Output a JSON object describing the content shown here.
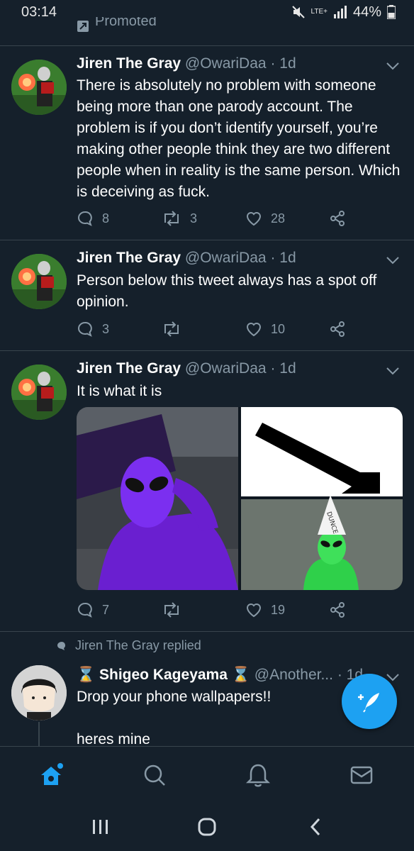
{
  "status_bar": {
    "time": "03:14",
    "network": "LTE+",
    "battery": "44%"
  },
  "promoted_label": "Promoted",
  "tweets": [
    {
      "name": "Jiren The Gray",
      "handle": "@OwariDaa",
      "sep": "·",
      "time": "1d",
      "text": "There is absolutely no problem with someone being more than one parody account. The problem is if you don’t identify yourself, you’re making other people think they are two different people when in reality is the same person. Which is deceiving as fuck.",
      "replies": "8",
      "retweets": "3",
      "likes": "28"
    },
    {
      "name": "Jiren The Gray",
      "handle": "@OwariDaa",
      "sep": "·",
      "time": "1d",
      "text": "Person below this tweet always has a spot off opinion.",
      "replies": "3",
      "retweets": "",
      "likes": "10"
    },
    {
      "name": "Jiren The Gray",
      "handle": "@OwariDaa",
      "sep": "·",
      "time": "1d",
      "text": "It is what it is",
      "replies": "7",
      "retweets": "",
      "likes": "19",
      "dunce_text": "DUNCE"
    },
    {
      "name": "Shigeo Kageyama",
      "handle": "@Another...",
      "sep": "·",
      "time": "1d",
      "text_line1": "Drop your phone wallpapers!!",
      "text_line2": "heres mine"
    }
  ],
  "replied_label": "Jiren The Gray replied",
  "icons": {
    "reply": "reply-icon",
    "retweet": "retweet-icon",
    "like": "heart-icon",
    "share": "share-icon",
    "home": "home-icon",
    "search": "search-icon",
    "notifications": "bell-icon",
    "messages": "mail-icon",
    "compose": "compose-icon"
  },
  "colors": {
    "background": "#15202b",
    "accent": "#1da1f2",
    "muted": "#8899a6"
  }
}
